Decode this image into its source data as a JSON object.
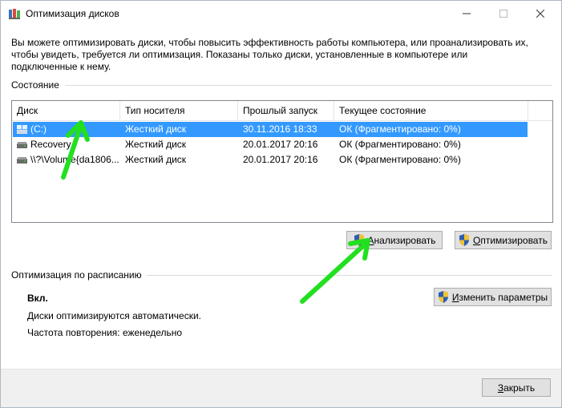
{
  "window": {
    "title": "Оптимизация дисков",
    "intro": "Вы можете оптимизировать диски, чтобы повысить эффективность работы  компьютера, или проанализировать их, чтобы увидеть, требуется ли оптимизация. Показаны только диски, установленные в компьютере или подключенные к нему."
  },
  "status": {
    "label": "Состояние",
    "columns": [
      "Диск",
      "Тип носителя",
      "Прошлый запуск",
      "Текущее состояние"
    ],
    "rows": [
      {
        "disk": "(C:)",
        "media": "Жесткий диск",
        "last_run": "30.11.2016 18:33",
        "state": "ОК (Фрагментировано: 0%)",
        "selected": true,
        "icon": "system-drive-icon"
      },
      {
        "disk": "Recovery",
        "media": "Жесткий диск",
        "last_run": "20.01.2017 20:16",
        "state": "ОК (Фрагментировано: 0%)",
        "selected": false,
        "icon": "drive-icon"
      },
      {
        "disk": "\\\\?\\Volume{da1806...",
        "media": "Жесткий диск",
        "last_run": "20.01.2017 20:16",
        "state": "ОК (Фрагментировано: 0%)",
        "selected": false,
        "icon": "drive-icon"
      }
    ]
  },
  "buttons": {
    "analyze_first": "А",
    "analyze_rest": "нализировать",
    "optimize_first": "О",
    "optimize_rest": "птимизировать",
    "change_first": "И",
    "change_rest": "зменить параметры",
    "close_first": "З",
    "close_rest": "акрыть"
  },
  "schedule": {
    "label": "Оптимизация по расписанию",
    "state": "Вкл.",
    "line1": "Диски оптимизируются автоматически.",
    "line2": "Частота повторения: еженедельно"
  },
  "colors": {
    "selection": "#3399ff",
    "annotation_arrow": "#22e01f"
  }
}
